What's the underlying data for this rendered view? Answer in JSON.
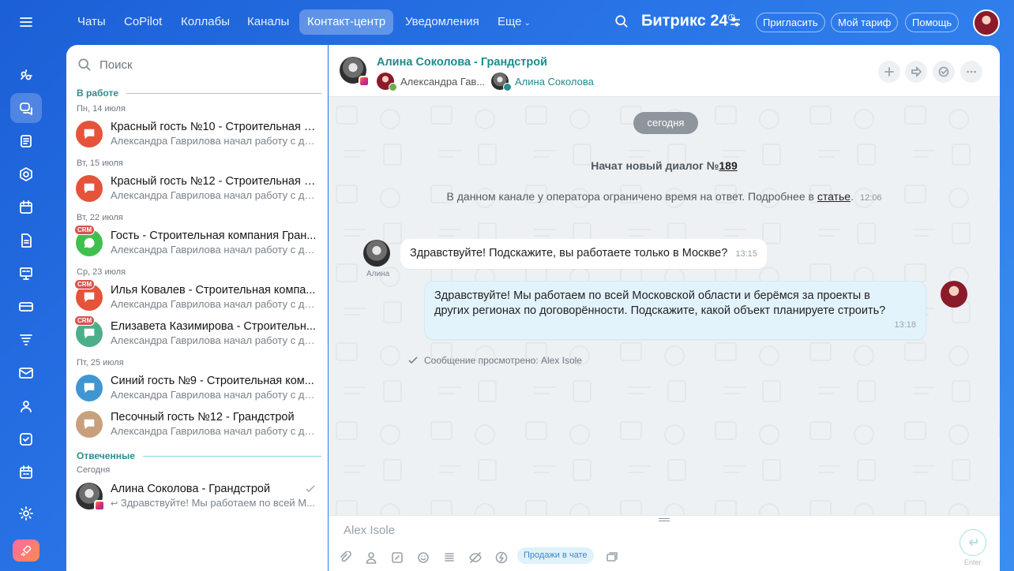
{
  "colors": {
    "accent": "#2a8d8f",
    "crm_badge": "#d9534f",
    "active_nav": "rgba(255,255,255,0.28)"
  },
  "rail": {
    "icons": [
      "menu-icon",
      "copilot-icon",
      "chats-icon",
      "feed-icon",
      "hexagon-icon",
      "calendar-icon",
      "document-icon",
      "presentation-icon",
      "card-icon",
      "filter-icon",
      "mail-icon",
      "users-icon",
      "tasks-icon",
      "schedule-icon",
      "settings-icon",
      "rocket-icon"
    ]
  },
  "topnav": {
    "items": [
      "Чаты",
      "CoPilot",
      "Коллабы",
      "Каналы",
      "Контакт-центр",
      "Уведомления",
      "Еще"
    ],
    "brand": "Битрикс",
    "brand_num": "24",
    "invite": "Пригласить",
    "tariff": "Мой тариф",
    "help": "Помощь"
  },
  "list": {
    "search_placeholder": "Поиск",
    "group_active": "В работе",
    "group_answered": "Отвеченные",
    "dates": [
      "Пн, 14 июля",
      "Вт, 15 июля",
      "Вт, 22 июля",
      "Ср, 23 июля",
      "Пт, 25 июля",
      "Сегодня"
    ],
    "crm_label": "CRM",
    "items": [
      {
        "title": "Красный гость №10 - Строительная к...",
        "sub": "Александра Гаврилова начал работу с ди..."
      },
      {
        "title": "Красный гость №12 - Строительная к...",
        "sub": "Александра Гаврилова начал работу с ди..."
      },
      {
        "title": "Гость - Строительная компания Гран...",
        "sub": "Александра Гаврилова начал работу с ди..."
      },
      {
        "title": "Илья Ковалев - Строительная компа...",
        "sub": "Александра Гаврилова начал работу с ди..."
      },
      {
        "title": "Елизавета Казимирова - Строительн...",
        "sub": "Александра Гаврилова начал работу с ди..."
      },
      {
        "title": "Синий гость №9 - Строительная ком...",
        "sub": "Александра Гаврилова начал работу с ди..."
      },
      {
        "title": "Песочный гость №12 - Грандстрой",
        "sub": "Александра Гаврилова начал работу с ди..."
      },
      {
        "title": "Алина Соколова - Грандстрой",
        "sub": "Здравствуйте! Мы работаем по всей М..."
      }
    ]
  },
  "conversation": {
    "title": "Алина Соколова - Грандстрой",
    "participant_1": "Александра Гав...",
    "participant_2": "Алина Соколова",
    "day_chip": "сегодня",
    "dialog_start_prefix": "Начат новый диалог №",
    "dialog_number": "189",
    "notice_text": "В данном канале у оператора ограничено время на ответ. Подробнее в ",
    "notice_link": "статье",
    "notice_dot": ".",
    "notice_time": "12:06",
    "msg_in_author": "Алина",
    "msg_in_text": "Здравствуйте! Подскажите, вы работаете только в Москве?",
    "msg_in_time": "13:15",
    "msg_out_text": "Здравствуйте! Мы работаем по всей Московской области и берёмся за проекты в других регионах по договорённости. Подскажите, какой объект планируете строить?",
    "msg_out_time": "13:18",
    "seen_text": "Сообщение просмотрено: Alex Isole"
  },
  "composer": {
    "placeholder": "Alex Isole",
    "sales_chip": "Продажи в чате",
    "enter_hint": "Enter"
  }
}
